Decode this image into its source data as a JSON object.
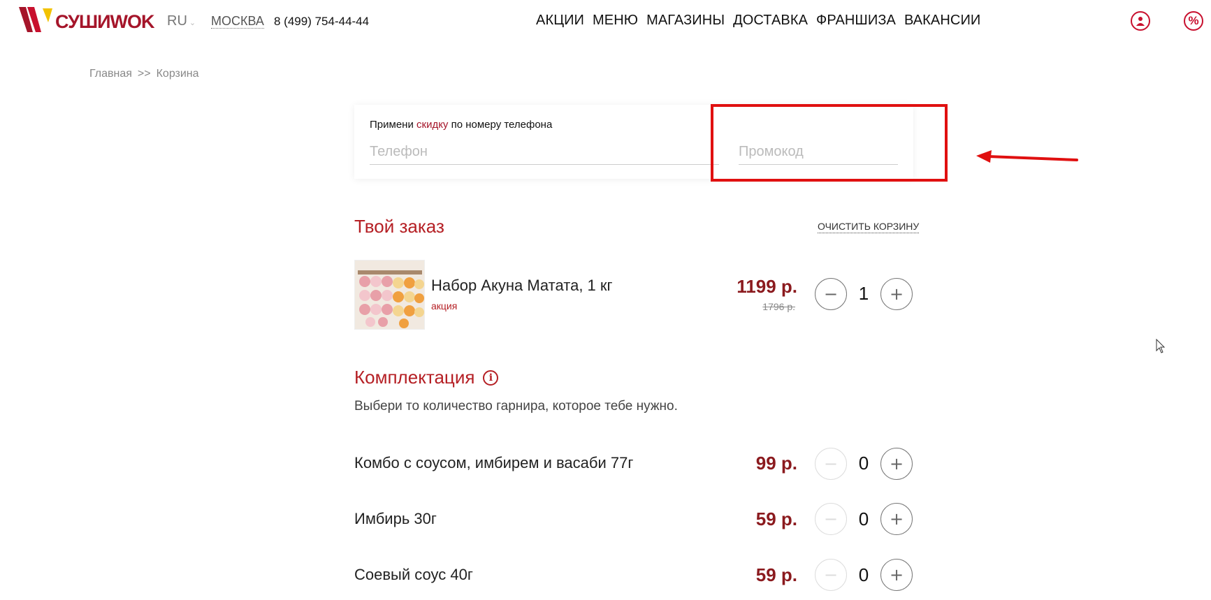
{
  "header": {
    "logo_text": "СУШИWOK",
    "lang": "RU",
    "city": "МОСКВА",
    "phone": "8 (499) 754-44-44",
    "nav": [
      "АКЦИИ",
      "МЕНЮ",
      "МАГАЗИНЫ",
      "ДОСТАВКА",
      "ФРАНШИЗА",
      "ВАКАНСИИ"
    ],
    "icons": [
      "user-icon",
      "percent-icon"
    ]
  },
  "breadcrumb": {
    "home": "Главная",
    "separator": ">>",
    "current": "Корзина"
  },
  "promo": {
    "label_before": "Примени ",
    "label_accent": "скидку",
    "label_after": " по номеру телефона",
    "phone_placeholder": "Телефон",
    "promo_placeholder": "Промокод"
  },
  "order": {
    "title": "Твой заказ",
    "clear_label": "ОЧИСТИТЬ КОРЗИНУ",
    "items": [
      {
        "name": "Набор Акуна Матата, 1 кг",
        "badge": "акция",
        "price": "1199 р.",
        "old_price": "1796 р.",
        "qty": "1"
      }
    ]
  },
  "completion": {
    "title": "Комплектация",
    "info_icon_glyph": "i",
    "description": "Выбери то количество гарнира, которое тебе нужно.",
    "items": [
      {
        "name": "Комбо с соусом, имбирем и васаби 77г",
        "price": "99 р.",
        "qty": "0"
      },
      {
        "name": "Имбирь 30г",
        "price": "59 р.",
        "qty": "0"
      },
      {
        "name": "Соевый соус 40г",
        "price": "59 р.",
        "qty": "0"
      }
    ]
  },
  "controls": {
    "minus": "−",
    "plus": "+"
  },
  "colors": {
    "brand": "#b51f24",
    "price": "#8b1a1e",
    "annotation": "#e01010"
  }
}
